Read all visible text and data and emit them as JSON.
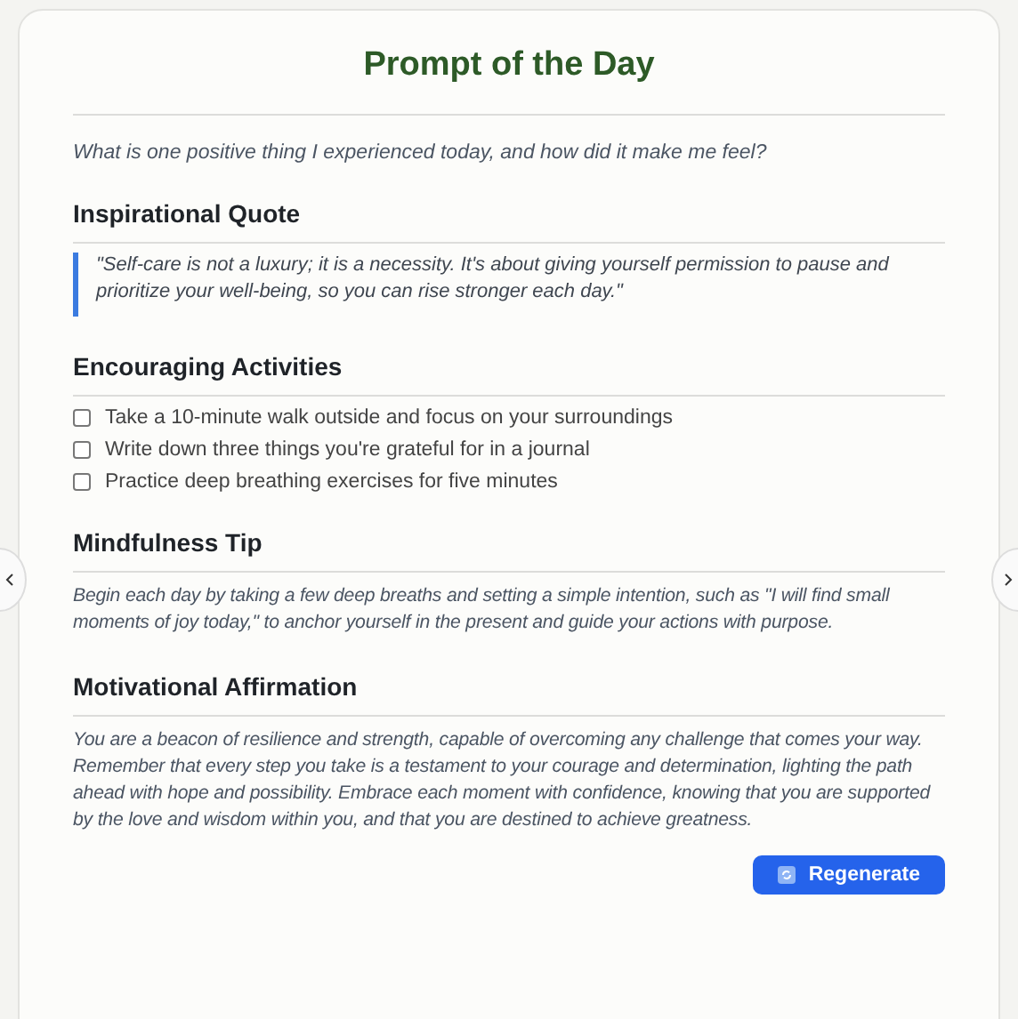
{
  "title": "Prompt of the Day",
  "prompt": "What is one positive thing I experienced today, and how did it make me feel?",
  "sections": [
    {
      "kind": "quote",
      "heading": "Inspirational Quote",
      "text": "\"Self-care is not a luxury; it is a necessity. It's about giving yourself permission to pause and prioritize your well-being, so you can rise stronger each day.\""
    },
    {
      "kind": "checklist",
      "heading": "Encouraging Activities",
      "items": [
        {
          "label": "Take a 10-minute walk outside and focus on your surroundings",
          "checked": false
        },
        {
          "label": "Write down three things you're grateful for in a journal",
          "checked": false
        },
        {
          "label": "Practice deep breathing exercises for five minutes",
          "checked": false
        }
      ]
    },
    {
      "kind": "text",
      "heading": "Mindfulness Tip",
      "text": "Begin each day by taking a few deep breaths and setting a simple intention, such as \"I will find small moments of joy today,\" to anchor yourself in the present and guide your actions with purpose."
    },
    {
      "kind": "text",
      "heading": "Motivational Affirmation",
      "text": "You are a beacon of resilience and strength, capable of overcoming any challenge that comes your way. Remember that every step you take is a testament to your courage and determination, lighting the path ahead with hope and possibility. Embrace each moment with confidence, knowing that you are supported by the love and wisdom within you, and that you are destined to achieve greatness."
    }
  ],
  "button": "Regenerate"
}
